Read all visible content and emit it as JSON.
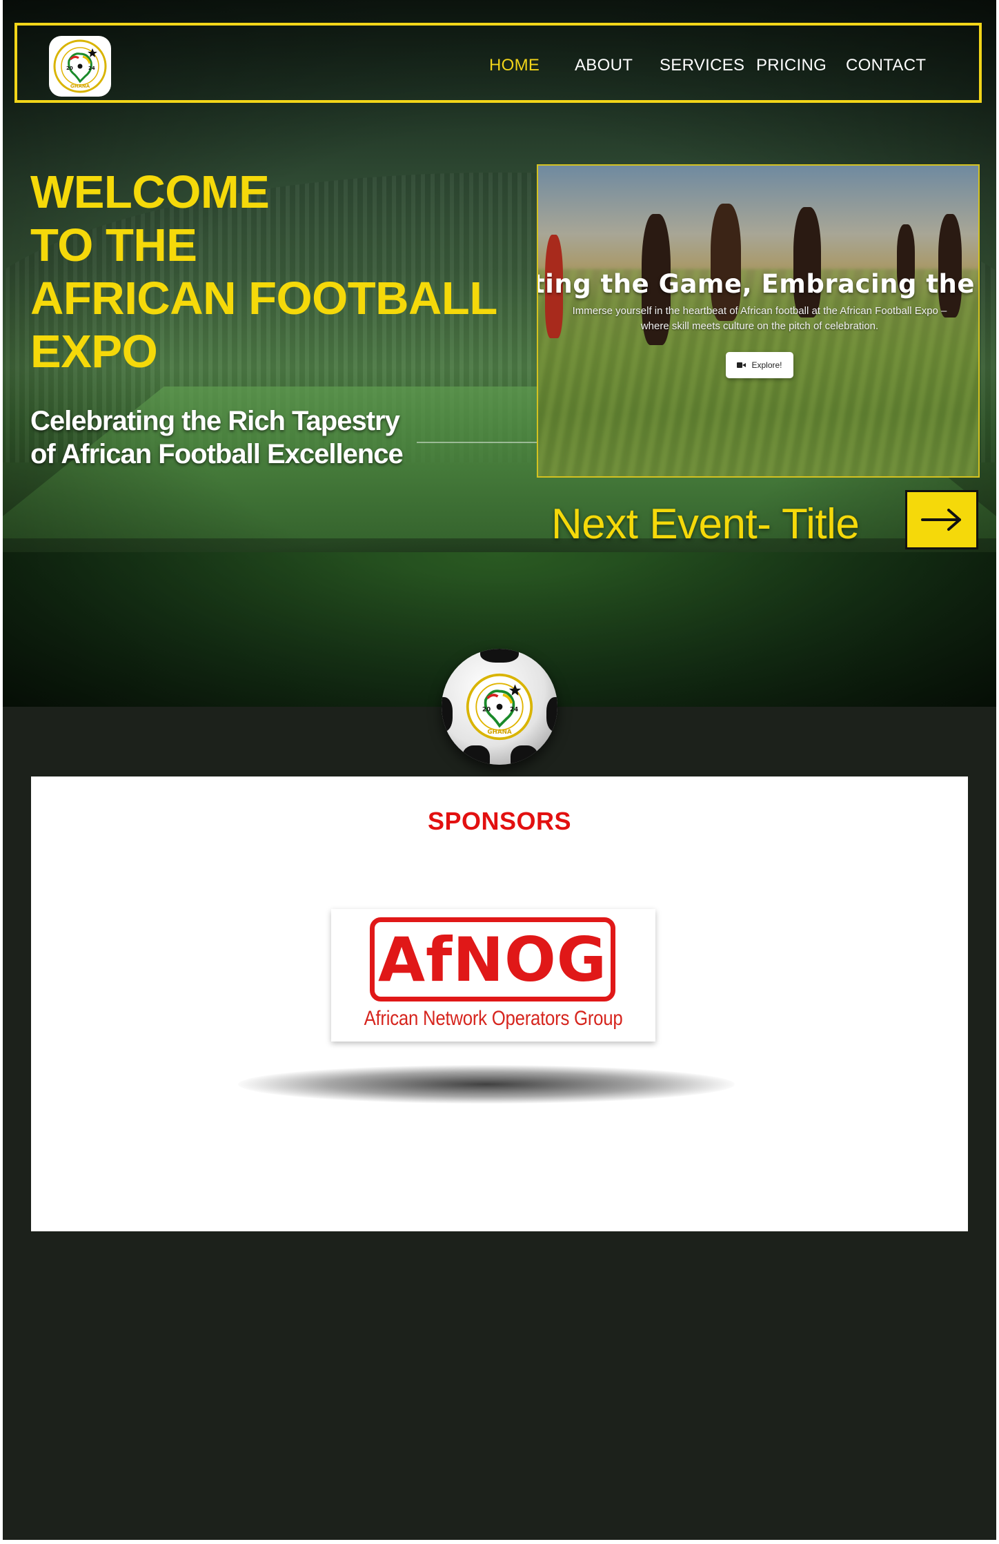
{
  "brand": {
    "logo_alt": "African Football Expo 2024 Ghana logo",
    "logo_ring_text": "AFRICAN FOOTBALL EXP",
    "logo_year_left": "20",
    "logo_year_right": "24",
    "logo_country": "GHANA",
    "colors": {
      "accent": "#f5d90a",
      "nav_border": "#f2d519",
      "dark_bg": "#1c211b",
      "sponsor_red": "#e21010"
    }
  },
  "nav": {
    "items": [
      {
        "label": "HOME",
        "active": true
      },
      {
        "label": "ABOUT",
        "active": false
      },
      {
        "label": "SERVICES",
        "active": false
      },
      {
        "label": "PRICING",
        "active": false
      },
      {
        "label": "CONTACT",
        "active": false
      }
    ]
  },
  "hero": {
    "title_lines": [
      "WELCOME",
      "TO THE",
      "AFRICAN FOOTBALL",
      "EXPO"
    ],
    "subtitle_lines": [
      "Celebrating the Rich Tapestry",
      "of African Football Excellence"
    ]
  },
  "video": {
    "heading": "ting the Game, Embracing the Cu",
    "description_lines": [
      "Immerse yourself in the heartbeat of African football at the African Football Expo –",
      "where skill meets culture on the pitch of celebration."
    ],
    "button_label": "Explore!",
    "button_icon": "video-camera-icon"
  },
  "next_event": {
    "label": "Next Event- Title",
    "arrow_icon": "arrow-right-icon"
  },
  "sponsors": {
    "title": "SPONSORS",
    "items": [
      {
        "name": "AfNOG",
        "subtitle": "African Network Operators Group"
      }
    ]
  }
}
